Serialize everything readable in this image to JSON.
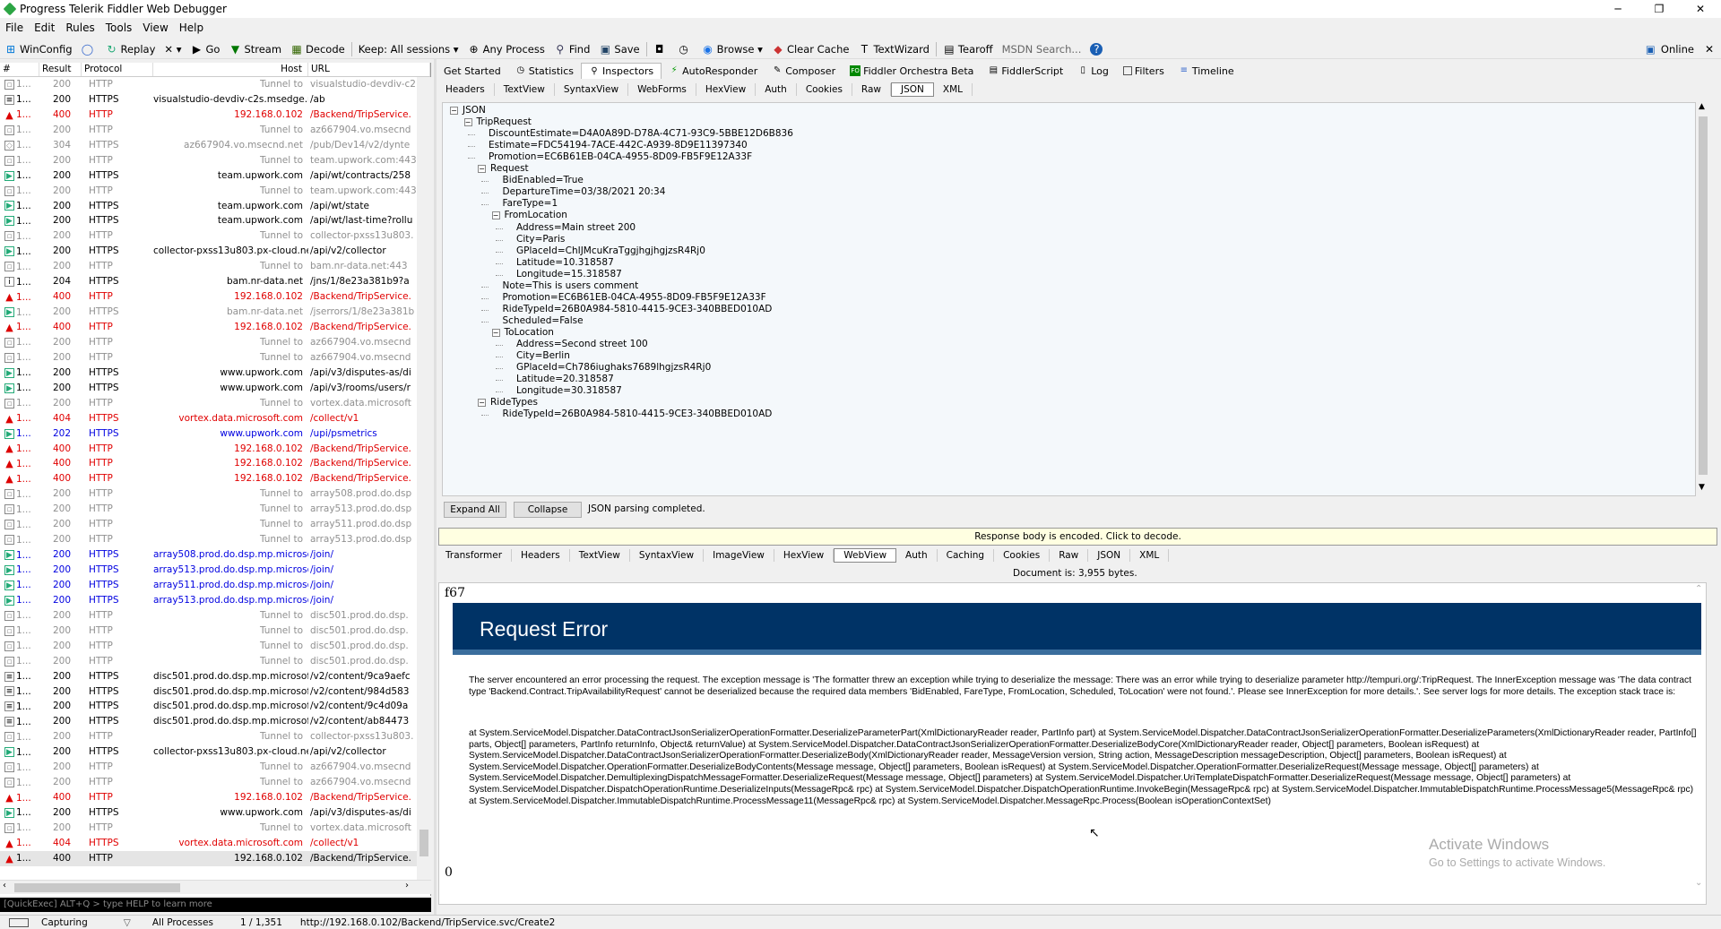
{
  "window": {
    "title": "Progress Telerik Fiddler Web Debugger",
    "minimize": "─",
    "maximize": "❐",
    "close": "✕"
  },
  "menu": [
    "File",
    "Edit",
    "Rules",
    "Tools",
    "View",
    "Help"
  ],
  "toolbar": {
    "winconfig": "WinConfig",
    "replay": "Replay",
    "remove": "✕ ▾",
    "go": "Go",
    "stream": "Stream",
    "decode": "Decode",
    "keep": "Keep: All sessions ▾",
    "any_process": "Any Process",
    "find": "Find",
    "save": "Save",
    "browse": "Browse ▾",
    "clear_cache": "Clear Cache",
    "textwizard": "TextWizard",
    "tearoff": "Tearoff",
    "msdn": "MSDN Search...",
    "online": "Online",
    "close": "✕"
  },
  "sessions": {
    "headers": {
      "num": "#",
      "result": "Result",
      "protocol": "Protocol",
      "host": "Host",
      "url": "URL"
    },
    "rows": [
      {
        "id": "1...",
        "result": "200",
        "protocol": "HTTP",
        "host": "Tunnel to",
        "url": "visualstudio-devdiv-c2",
        "style": "gray",
        "icon": "lock"
      },
      {
        "id": "1...",
        "result": "200",
        "protocol": "HTTPS",
        "host": "visualstudio-devdiv-c2s.msedge.net",
        "url": "/ab",
        "style": "",
        "icon": "doc"
      },
      {
        "id": "1...",
        "result": "400",
        "protocol": "HTTP",
        "host": "192.168.0.102",
        "url": "/Backend/TripService.",
        "style": "red",
        "icon": "warn"
      },
      {
        "id": "1...",
        "result": "200",
        "protocol": "HTTP",
        "host": "Tunnel to",
        "url": "az667904.vo.msecnd",
        "style": "gray",
        "icon": "lock"
      },
      {
        "id": "1...",
        "result": "304",
        "protocol": "HTTPS",
        "host": "az667904.vo.msecnd.net",
        "url": "/pub/Dev14/v2/dynte",
        "style": "gray",
        "icon": "diamond"
      },
      {
        "id": "1...",
        "result": "200",
        "protocol": "HTTP",
        "host": "Tunnel to",
        "url": "team.upwork.com:443",
        "style": "gray",
        "icon": "lock"
      },
      {
        "id": "1...",
        "result": "200",
        "protocol": "HTTPS",
        "host": "team.upwork.com",
        "url": "/api/wt/contracts/258",
        "style": "",
        "icon": "js"
      },
      {
        "id": "1...",
        "result": "200",
        "protocol": "HTTP",
        "host": "Tunnel to",
        "url": "team.upwork.com:443",
        "style": "gray",
        "icon": "lock"
      },
      {
        "id": "1...",
        "result": "200",
        "protocol": "HTTPS",
        "host": "team.upwork.com",
        "url": "/api/wt/state",
        "style": "",
        "icon": "js"
      },
      {
        "id": "1...",
        "result": "200",
        "protocol": "HTTPS",
        "host": "team.upwork.com",
        "url": "/api/wt/last-time?rollu",
        "style": "",
        "icon": "js"
      },
      {
        "id": "1...",
        "result": "200",
        "protocol": "HTTP",
        "host": "Tunnel to",
        "url": "collector-pxss13u803.",
        "style": "gray",
        "icon": "lock"
      },
      {
        "id": "1...",
        "result": "200",
        "protocol": "HTTPS",
        "host": "collector-pxss13u803.px-cloud.net",
        "url": "/api/v2/collector",
        "style": "",
        "icon": "js"
      },
      {
        "id": "1...",
        "result": "200",
        "protocol": "HTTP",
        "host": "Tunnel to",
        "url": "bam.nr-data.net:443",
        "style": "gray",
        "icon": "lock"
      },
      {
        "id": "1...",
        "result": "204",
        "protocol": "HTTPS",
        "host": "bam.nr-data.net",
        "url": "/jns/1/8e23a381b9?a",
        "style": "",
        "icon": "info"
      },
      {
        "id": "1...",
        "result": "400",
        "protocol": "HTTP",
        "host": "192.168.0.102",
        "url": "/Backend/TripService.",
        "style": "red",
        "icon": "warn"
      },
      {
        "id": "1...",
        "result": "200",
        "protocol": "HTTPS",
        "host": "bam.nr-data.net",
        "url": "/jserrors/1/8e23a381b",
        "style": "gray",
        "icon": "js"
      },
      {
        "id": "1...",
        "result": "400",
        "protocol": "HTTP",
        "host": "192.168.0.102",
        "url": "/Backend/TripService.",
        "style": "red",
        "icon": "warn"
      },
      {
        "id": "1...",
        "result": "200",
        "protocol": "HTTP",
        "host": "Tunnel to",
        "url": "az667904.vo.msecnd",
        "style": "gray",
        "icon": "lock"
      },
      {
        "id": "1...",
        "result": "200",
        "protocol": "HTTP",
        "host": "Tunnel to",
        "url": "az667904.vo.msecnd",
        "style": "gray",
        "icon": "lock"
      },
      {
        "id": "1...",
        "result": "200",
        "protocol": "HTTPS",
        "host": "www.upwork.com",
        "url": "/api/v3/disputes-as/di",
        "style": "",
        "icon": "js"
      },
      {
        "id": "1...",
        "result": "200",
        "protocol": "HTTPS",
        "host": "www.upwork.com",
        "url": "/api/v3/rooms/users/r",
        "style": "",
        "icon": "js"
      },
      {
        "id": "1...",
        "result": "200",
        "protocol": "HTTP",
        "host": "Tunnel to",
        "url": "vortex.data.microsoft",
        "style": "gray",
        "icon": "lock"
      },
      {
        "id": "1...",
        "result": "404",
        "protocol": "HTTPS",
        "host": "vortex.data.microsoft.com",
        "url": "/collect/v1",
        "style": "red",
        "icon": "warn"
      },
      {
        "id": "1...",
        "result": "202",
        "protocol": "HTTPS",
        "host": "www.upwork.com",
        "url": "/upi/psmetrics",
        "style": "blue",
        "icon": "js"
      },
      {
        "id": "1...",
        "result": "400",
        "protocol": "HTTP",
        "host": "192.168.0.102",
        "url": "/Backend/TripService.",
        "style": "red",
        "icon": "warn"
      },
      {
        "id": "1...",
        "result": "400",
        "protocol": "HTTP",
        "host": "192.168.0.102",
        "url": "/Backend/TripService.",
        "style": "red",
        "icon": "warn"
      },
      {
        "id": "1...",
        "result": "400",
        "protocol": "HTTP",
        "host": "192.168.0.102",
        "url": "/Backend/TripService.",
        "style": "red",
        "icon": "warn"
      },
      {
        "id": "1...",
        "result": "200",
        "protocol": "HTTP",
        "host": "Tunnel to",
        "url": "array508.prod.do.dsp",
        "style": "gray",
        "icon": "lock"
      },
      {
        "id": "1...",
        "result": "200",
        "protocol": "HTTP",
        "host": "Tunnel to",
        "url": "array513.prod.do.dsp",
        "style": "gray",
        "icon": "lock"
      },
      {
        "id": "1...",
        "result": "200",
        "protocol": "HTTP",
        "host": "Tunnel to",
        "url": "array511.prod.do.dsp",
        "style": "gray",
        "icon": "lock"
      },
      {
        "id": "1...",
        "result": "200",
        "protocol": "HTTP",
        "host": "Tunnel to",
        "url": "array513.prod.do.dsp",
        "style": "gray",
        "icon": "lock"
      },
      {
        "id": "1...",
        "result": "200",
        "protocol": "HTTPS",
        "host": "array508.prod.do.dsp.mp.microsoft....",
        "url": "/join/",
        "style": "blue",
        "icon": "js"
      },
      {
        "id": "1...",
        "result": "200",
        "protocol": "HTTPS",
        "host": "array513.prod.do.dsp.mp.microsoft....",
        "url": "/join/",
        "style": "blue",
        "icon": "js"
      },
      {
        "id": "1...",
        "result": "200",
        "protocol": "HTTPS",
        "host": "array511.prod.do.dsp.mp.microsoft....",
        "url": "/join/",
        "style": "blue",
        "icon": "js"
      },
      {
        "id": "1...",
        "result": "200",
        "protocol": "HTTPS",
        "host": "array513.prod.do.dsp.mp.microsoft....",
        "url": "/join/",
        "style": "blue",
        "icon": "js"
      },
      {
        "id": "1...",
        "result": "200",
        "protocol": "HTTP",
        "host": "Tunnel to",
        "url": "disc501.prod.do.dsp.",
        "style": "gray",
        "icon": "lock"
      },
      {
        "id": "1...",
        "result": "200",
        "protocol": "HTTP",
        "host": "Tunnel to",
        "url": "disc501.prod.do.dsp.",
        "style": "gray",
        "icon": "lock"
      },
      {
        "id": "1...",
        "result": "200",
        "protocol": "HTTP",
        "host": "Tunnel to",
        "url": "disc501.prod.do.dsp.",
        "style": "gray",
        "icon": "lock"
      },
      {
        "id": "1...",
        "result": "200",
        "protocol": "HTTP",
        "host": "Tunnel to",
        "url": "disc501.prod.do.dsp.",
        "style": "gray",
        "icon": "lock"
      },
      {
        "id": "1...",
        "result": "200",
        "protocol": "HTTPS",
        "host": "disc501.prod.do.dsp.mp.microsoft.com",
        "url": "/v2/content/9ca9aefc",
        "style": "",
        "icon": "doc"
      },
      {
        "id": "1...",
        "result": "200",
        "protocol": "HTTPS",
        "host": "disc501.prod.do.dsp.mp.microsoft.com",
        "url": "/v2/content/984d583",
        "style": "",
        "icon": "doc"
      },
      {
        "id": "1...",
        "result": "200",
        "protocol": "HTTPS",
        "host": "disc501.prod.do.dsp.mp.microsoft.com",
        "url": "/v2/content/9c4d09a",
        "style": "",
        "icon": "doc"
      },
      {
        "id": "1...",
        "result": "200",
        "protocol": "HTTPS",
        "host": "disc501.prod.do.dsp.mp.microsoft.com",
        "url": "/v2/content/ab84473",
        "style": "",
        "icon": "doc"
      },
      {
        "id": "1...",
        "result": "200",
        "protocol": "HTTP",
        "host": "Tunnel to",
        "url": "collector-pxss13u803.",
        "style": "gray",
        "icon": "lock"
      },
      {
        "id": "1...",
        "result": "200",
        "protocol": "HTTPS",
        "host": "collector-pxss13u803.px-cloud.net",
        "url": "/api/v2/collector",
        "style": "",
        "icon": "js"
      },
      {
        "id": "1...",
        "result": "200",
        "protocol": "HTTP",
        "host": "Tunnel to",
        "url": "az667904.vo.msecnd",
        "style": "gray",
        "icon": "lock"
      },
      {
        "id": "1...",
        "result": "200",
        "protocol": "HTTP",
        "host": "Tunnel to",
        "url": "az667904.vo.msecnd",
        "style": "gray",
        "icon": "lock"
      },
      {
        "id": "1...",
        "result": "400",
        "protocol": "HTTP",
        "host": "192.168.0.102",
        "url": "/Backend/TripService.",
        "style": "red",
        "icon": "warn"
      },
      {
        "id": "1...",
        "result": "200",
        "protocol": "HTTPS",
        "host": "www.upwork.com",
        "url": "/api/v3/disputes-as/di",
        "style": "",
        "icon": "js"
      },
      {
        "id": "1...",
        "result": "200",
        "protocol": "HTTP",
        "host": "Tunnel to",
        "url": "vortex.data.microsoft",
        "style": "gray",
        "icon": "lock"
      },
      {
        "id": "1...",
        "result": "404",
        "protocol": "HTTPS",
        "host": "vortex.data.microsoft.com",
        "url": "/collect/v1",
        "style": "red",
        "icon": "warn"
      },
      {
        "id": "1...",
        "result": "400",
        "protocol": "HTTP",
        "host": "192.168.0.102",
        "url": "/Backend/TripService.",
        "style": "sel",
        "icon": "warn"
      }
    ]
  },
  "quickexec": "[QuickExec] ALT+Q > type HELP to learn more",
  "status": {
    "capturing": "Capturing",
    "processes": "All Processes",
    "count": "1 / 1,351",
    "url": "http://192.168.0.102/Backend/TripService.svc/Create2"
  },
  "top_tabs": [
    "Get Started",
    "Statistics",
    "Inspectors",
    "AutoResponder",
    "Composer",
    "Fiddler Orchestra Beta",
    "FiddlerScript",
    "Log",
    "Filters",
    "Timeline"
  ],
  "request_tabs": [
    "Headers",
    "TextView",
    "SyntaxView",
    "WebForms",
    "HexView",
    "Auth",
    "Cookies",
    "Raw",
    "JSON",
    "XML"
  ],
  "json_tree": [
    "JSON",
    "TripRequest",
    "DiscountEstimate=D4A0A89D-D78A-4C71-93C9-5BBE12D6B836",
    "Estimate=FDC54194-7ACE-442C-A939-8D9E11397340",
    "Promotion=EC6B61EB-04CA-4955-8D09-FB5F9E12A33F",
    "Request",
    "BidEnabled=True",
    "DepartureTime=03/38/2021 20:34",
    "FareType=1",
    "FromLocation",
    "Address=Main street 200",
    "City=Paris",
    "GPlaceId=ChIJMcuKraTggjhgjhgjzsR4Rj0",
    "Latitude=10.318587",
    "Longitude=15.318587",
    "Note=This is users comment",
    "Promotion=EC6B61EB-04CA-4955-8D09-FB5F9E12A33F",
    "RideTypeId=26B0A984-5810-4415-9CE3-340BBED010AD",
    "Scheduled=False",
    "ToLocation",
    "Address=Second street 100",
    "City=Berlin",
    "GPlaceId=Ch786iughaks7689lhgjzsR4Rj0",
    "Latitude=20.318587",
    "Longitude=30.318587",
    "RideTypes",
    "RideTypeId=26B0A984-5810-4415-9CE3-340BBED010AD"
  ],
  "json_buttons": {
    "expand": "Expand All",
    "collapse": "Collapse",
    "status": "JSON parsing completed."
  },
  "encoded_bar": "Response body is encoded. Click to decode.",
  "response_tabs": [
    "Transformer",
    "Headers",
    "TextView",
    "SyntaxView",
    "ImageView",
    "HexView",
    "WebView",
    "Auth",
    "Caching",
    "Cookies",
    "Raw",
    "JSON",
    "XML"
  ],
  "doc_info": "Document is: 3,955 bytes.",
  "webview": {
    "chunk_start": "f67",
    "title": "Request Error",
    "message": "The server encountered an error processing the request. The exception message is 'The formatter threw an exception while trying to deserialize the message: There was an error while trying to deserialize parameter http://tempuri.org/:TripRequest. The InnerException message was 'The data contract type 'Backend.Contract.TripAvailabilityRequest' cannot be deserialized because the required data members 'BidEnabled, FareType, FromLocation, Scheduled, ToLocation' were not found.'. Please see InnerException for more details.'. See server logs for more details. The exception stack trace is:",
    "trace": "at System.ServiceModel.Dispatcher.DataContractJsonSerializerOperationFormatter.DeserializeParameterPart(XmlDictionaryReader reader, PartInfo part) at System.ServiceModel.Dispatcher.DataContractJsonSerializerOperationFormatter.DeserializeParameters(XmlDictionaryReader reader, PartInfo[] parts, Object[] parameters, PartInfo returnInfo, Object& returnValue) at System.ServiceModel.Dispatcher.DataContractJsonSerializerOperationFormatter.DeserializeBodyCore(XmlDictionaryReader reader, Object[] parameters, Boolean isRequest) at System.ServiceModel.Dispatcher.DataContractJsonSerializerOperationFormatter.DeserializeBody(XmlDictionaryReader reader, MessageVersion version, String action, MessageDescription messageDescription, Object[] parameters, Boolean isRequest) at System.ServiceModel.Dispatcher.OperationFormatter.DeserializeBodyContents(Message message, Object[] parameters, Boolean isRequest) at System.ServiceModel.Dispatcher.OperationFormatter.DeserializeRequest(Message message, Object[] parameters) at System.ServiceModel.Dispatcher.DemultiplexingDispatchMessageFormatter.DeserializeRequest(Message message, Object[] parameters) at System.ServiceModel.Dispatcher.UriTemplateDispatchFormatter.DeserializeRequest(Message message, Object[] parameters) at System.ServiceModel.Dispatcher.DispatchOperationRuntime.DeserializeInputs(MessageRpc& rpc) at System.ServiceModel.Dispatcher.DispatchOperationRuntime.InvokeBegin(MessageRpc& rpc) at System.ServiceModel.Dispatcher.ImmutableDispatchRuntime.ProcessMessage5(MessageRpc& rpc) at System.ServiceModel.Dispatcher.ImmutableDispatchRuntime.ProcessMessage11(MessageRpc& rpc) at System.ServiceModel.Dispatcher.MessageRpc.Process(Boolean isOperationContextSet)",
    "chunk_end": "0",
    "activate_title": "Activate Windows",
    "activate_sub": "Go to Settings to activate Windows."
  }
}
